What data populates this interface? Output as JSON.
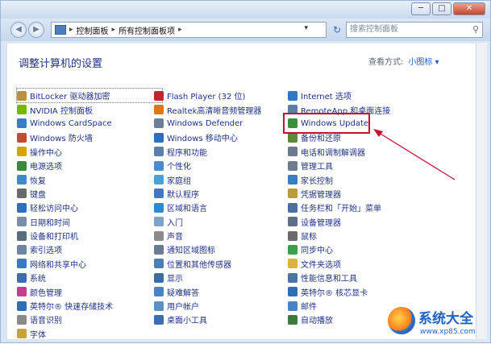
{
  "window": {
    "minimize": "─",
    "maximize": "□",
    "close": "✕"
  },
  "nav": {
    "back": "◀",
    "forward": "▶",
    "breadcrumb": [
      "控制面板",
      "所有控制面板项"
    ],
    "refresh": "↻",
    "search_placeholder": "搜索控制面板"
  },
  "header": {
    "title": "调整计算机的设置",
    "view_by_label": "查看方式:",
    "view_by_value": "小图标 ▾"
  },
  "columns": [
    [
      {
        "label": "BitLocker 驱动器加密",
        "color": "#b8913a"
      },
      {
        "label": "NVIDIA 控制面板",
        "color": "#76b900"
      },
      {
        "label": "Windows CardSpace",
        "color": "#3d7cc9"
      },
      {
        "label": "Windows 防火墙",
        "color": "#c14c2e"
      },
      {
        "label": "操作中心",
        "color": "#d9a300"
      },
      {
        "label": "电源选项",
        "color": "#3b8a3a"
      },
      {
        "label": "恢复",
        "color": "#3f8acb"
      },
      {
        "label": "键盘",
        "color": "#6b6b6b"
      },
      {
        "label": "轻松访问中心",
        "color": "#2b6fc2"
      },
      {
        "label": "日期和时间",
        "color": "#7a8ea8"
      },
      {
        "label": "设备和打印机",
        "color": "#5a6c80"
      },
      {
        "label": "索引选项",
        "color": "#6f86a3"
      },
      {
        "label": "网络和共享中心",
        "color": "#3a79c4"
      },
      {
        "label": "系统",
        "color": "#3d6fae"
      },
      {
        "label": "颜色管理",
        "color": "#c23d8a"
      },
      {
        "label": "英特尔® 快速存储技术",
        "color": "#2f6db5"
      },
      {
        "label": "语音识别",
        "color": "#8a8a8a"
      },
      {
        "label": "字体",
        "color": "#c8a232"
      }
    ],
    [
      {
        "label": "Flash Player (32 位)",
        "color": "#c0262d"
      },
      {
        "label": "Realtek高清晰音频管理器",
        "color": "#d87a1c"
      },
      {
        "label": "Windows Defender",
        "color": "#6e7f95"
      },
      {
        "label": "Windows 移动中心",
        "color": "#2c6fbe"
      },
      {
        "label": "程序和功能",
        "color": "#5a7fa8"
      },
      {
        "label": "个性化",
        "color": "#4a8bd0"
      },
      {
        "label": "家庭组",
        "color": "#4aa1d8"
      },
      {
        "label": "默认程序",
        "color": "#3f7ac0"
      },
      {
        "label": "区域和语言",
        "color": "#2e8ad0"
      },
      {
        "label": "入门",
        "color": "#7fa2c9"
      },
      {
        "label": "声音",
        "color": "#8b8b8b"
      },
      {
        "label": "通知区域图标",
        "color": "#6a7c92"
      },
      {
        "label": "位置和其他传感器",
        "color": "#4b80b5"
      },
      {
        "label": "显示",
        "color": "#3a6ea8"
      },
      {
        "label": "疑难解答",
        "color": "#4a83c5"
      },
      {
        "label": "用户帐户",
        "color": "#5e8fc4"
      },
      {
        "label": "桌面小工具",
        "color": "#3c6fb0"
      }
    ],
    [
      {
        "label": "Internet 选项",
        "color": "#2e78c8"
      },
      {
        "label": "RemoteApp 和桌面连接",
        "color": "#5b7ea6"
      },
      {
        "label": "Windows Update",
        "color": "#3c8e3c"
      },
      {
        "label": "备份和还原",
        "color": "#5a8a3a"
      },
      {
        "label": "电话和调制解调器",
        "color": "#6a7b8e"
      },
      {
        "label": "管理工具",
        "color": "#6e7e92"
      },
      {
        "label": "家长控制",
        "color": "#3c7cc4"
      },
      {
        "label": "凭据管理器",
        "color": "#c1983c"
      },
      {
        "label": "任务栏和「开始」菜单",
        "color": "#4a6fa0"
      },
      {
        "label": "设备管理器",
        "color": "#5e7088"
      },
      {
        "label": "鼠标",
        "color": "#6b6b6b"
      },
      {
        "label": "同步中心",
        "color": "#3aa04a"
      },
      {
        "label": "文件夹选项",
        "color": "#d9b33c"
      },
      {
        "label": "性能信息和工具",
        "color": "#4a74a6"
      },
      {
        "label": "英特尔® 核芯显卡",
        "color": "#2f6db5"
      },
      {
        "label": "邮件",
        "color": "#4a83c5"
      },
      {
        "label": "自动播放",
        "color": "#3d7a3d"
      }
    ]
  ],
  "watermark": {
    "name": "系统大全",
    "url": "www.xp85.com"
  }
}
